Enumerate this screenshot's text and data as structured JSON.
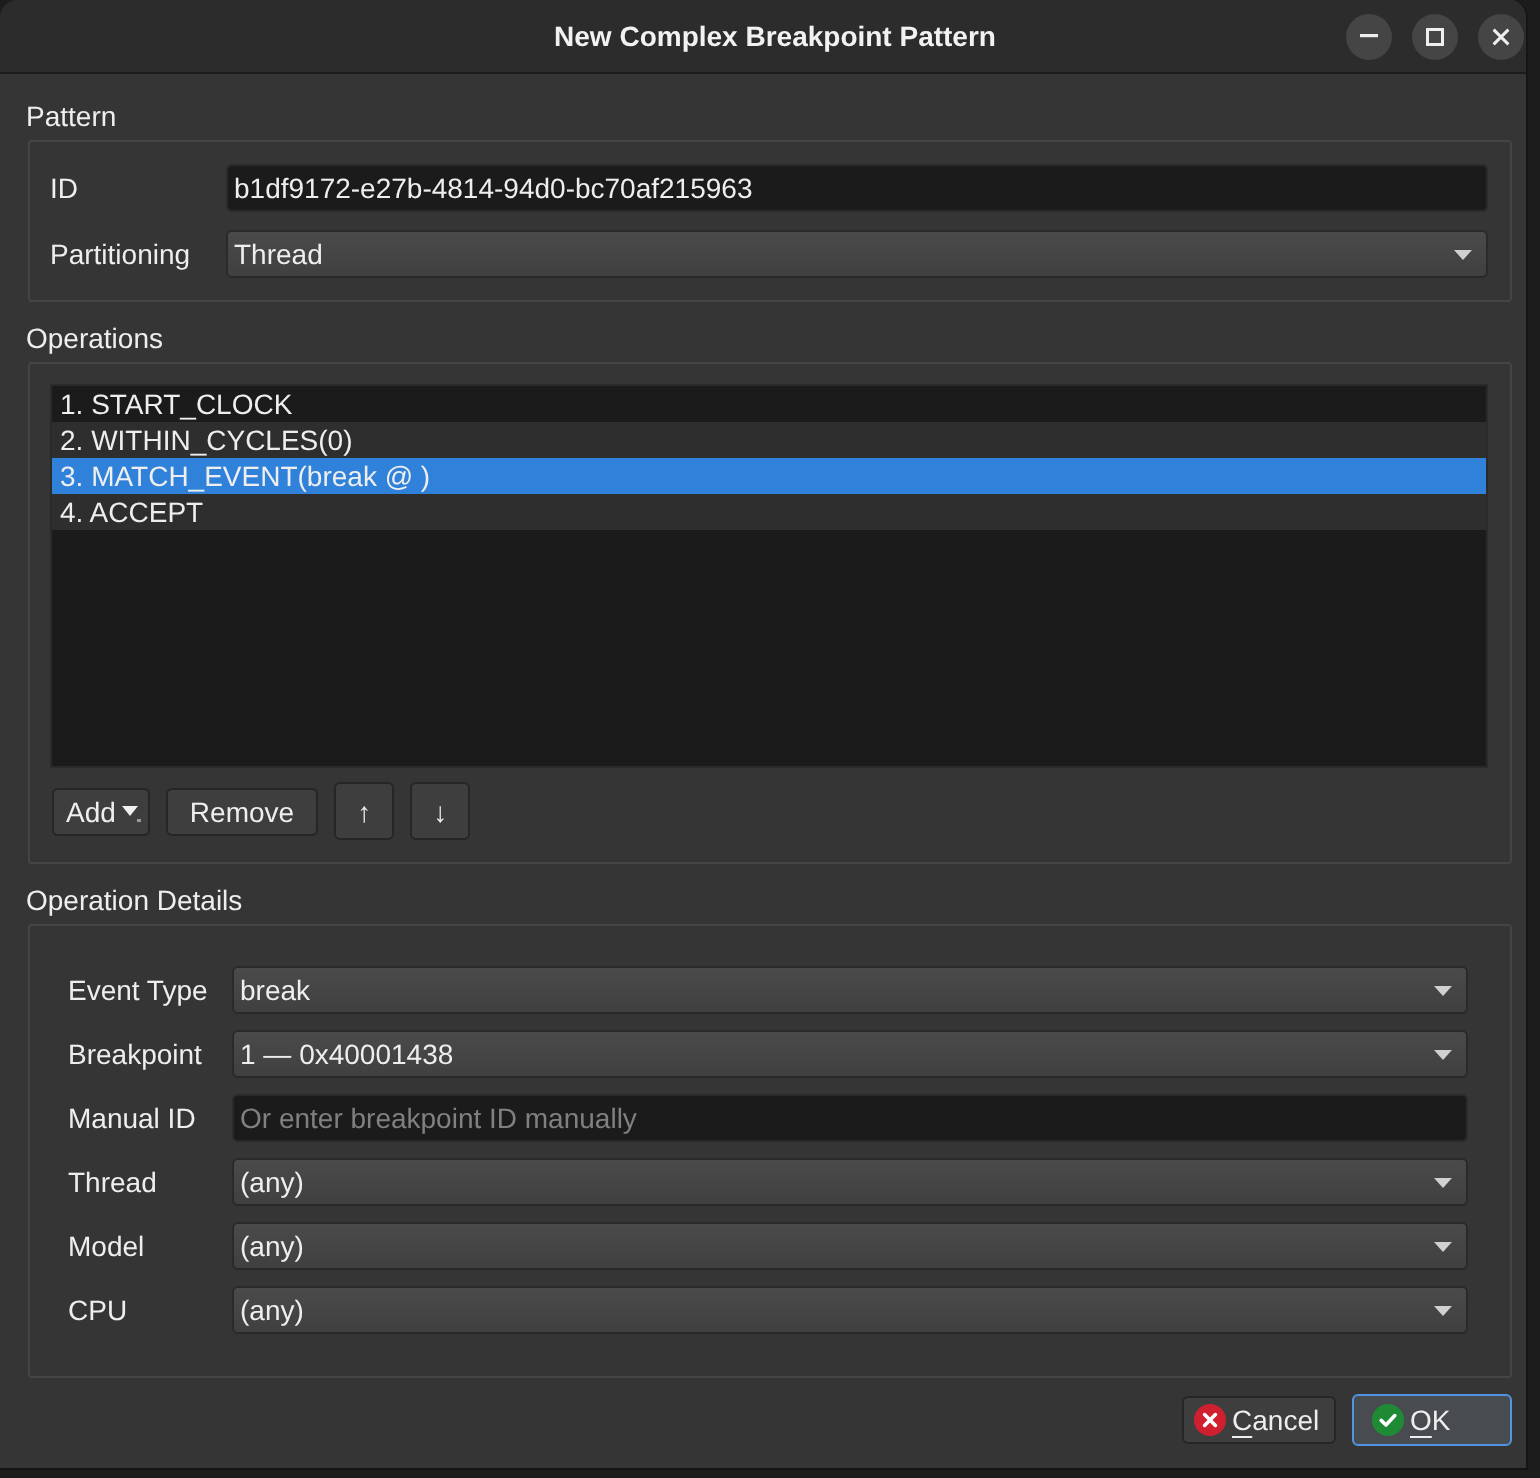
{
  "window": {
    "title": "New Complex Breakpoint Pattern"
  },
  "pattern": {
    "title": "Pattern",
    "fields": [
      {
        "kind": "text",
        "label": "ID",
        "value": "b1df9172-e27b-4814-94d0-bc70af215963"
      },
      {
        "kind": "combo",
        "label": "Partitioning",
        "value": "Thread"
      }
    ]
  },
  "operations": {
    "title": "Operations",
    "items": [
      {
        "label": "1. START_CLOCK",
        "selected": false
      },
      {
        "label": "2. WITHIN_CYCLES(0)",
        "selected": false
      },
      {
        "label": "3. MATCH_EVENT(break @ )",
        "selected": true
      },
      {
        "label": "4. ACCEPT",
        "selected": false
      }
    ],
    "buttons": [
      {
        "kind": "menu",
        "label": "Add"
      },
      {
        "kind": "plain",
        "label": "Remove"
      },
      {
        "kind": "square",
        "label": "↑"
      },
      {
        "kind": "square",
        "label": "↓"
      }
    ]
  },
  "operation_details": {
    "title": "Operation Details",
    "fields": [
      {
        "kind": "combo",
        "label": "Event Type",
        "value": "break"
      },
      {
        "kind": "combo",
        "label": "Breakpoint",
        "value": "1 — 0x40001438"
      },
      {
        "kind": "text",
        "label": "Manual ID",
        "placeholder": "Or enter breakpoint ID manually"
      },
      {
        "kind": "combo",
        "label": "Thread",
        "value": "(any)"
      },
      {
        "kind": "combo",
        "label": "Model",
        "value": "(any)"
      },
      {
        "kind": "combo",
        "label": "CPU",
        "value": "(any)"
      }
    ]
  },
  "buttons": [
    {
      "kind": "cancel",
      "label": "Cancel",
      "mnemonic": true,
      "default": false
    },
    {
      "kind": "ok",
      "label": "OK",
      "mnemonic": true,
      "default": true
    }
  ]
}
